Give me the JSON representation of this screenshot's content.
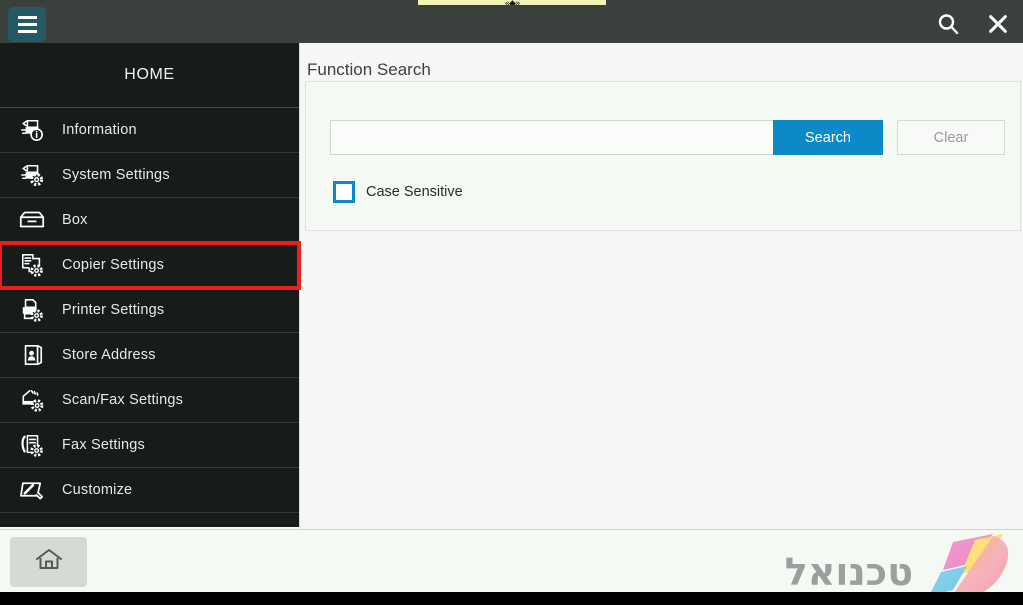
{
  "notification": {
    "marker": "«◆»"
  },
  "topbar": {
    "menu_button_name": "Menu",
    "search_icon": "search-icon",
    "close_icon": "close-icon"
  },
  "sidebar": {
    "header": "HOME",
    "items": [
      {
        "label": "Information",
        "icon": "printer-info-icon",
        "highlighted": false
      },
      {
        "label": "System Settings",
        "icon": "printer-gear-icon",
        "highlighted": false
      },
      {
        "label": "Box",
        "icon": "inbox-tray-icon",
        "highlighted": false
      },
      {
        "label": "Copier Settings",
        "icon": "copier-gear-icon",
        "highlighted": true
      },
      {
        "label": "Printer Settings",
        "icon": "printer-page-gear-icon",
        "highlighted": false
      },
      {
        "label": "Store Address",
        "icon": "address-book-icon",
        "highlighted": false
      },
      {
        "label": "Scan/Fax Settings",
        "icon": "scanner-gear-icon",
        "highlighted": false
      },
      {
        "label": "Fax Settings",
        "icon": "fax-gear-icon",
        "highlighted": false
      },
      {
        "label": "Customize",
        "icon": "pencil-edit-icon",
        "highlighted": false
      }
    ],
    "highlight_color": "#ee1c1c"
  },
  "main": {
    "title": "Function Search",
    "search": {
      "value": "",
      "placeholder": "",
      "search_label": "Search",
      "clear_label": "Clear",
      "search_button_color": "#0b8ac7",
      "clear_disabled": true
    },
    "case_sensitive": {
      "label": "Case Sensitive",
      "checked": false,
      "accent_color": "#0b8ac7"
    }
  },
  "bottombar": {
    "home_icon": "home-icon",
    "brand_text": "טכנואל"
  }
}
